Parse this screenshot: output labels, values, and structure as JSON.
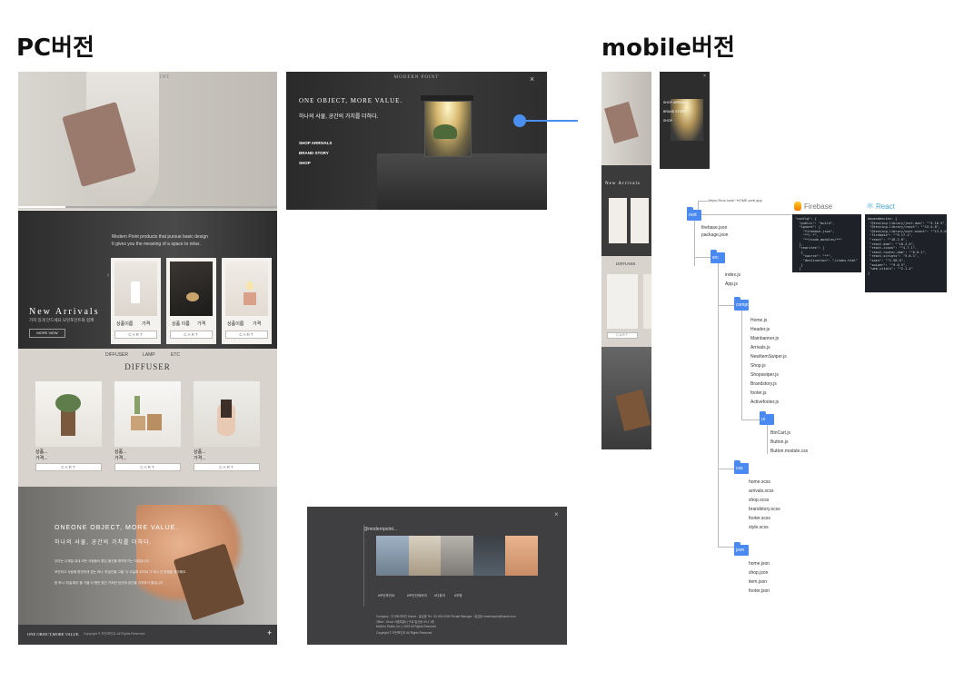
{
  "headings": {
    "pc": "PC버전",
    "mobile": "mobile버전"
  },
  "brand": "MODERN POINT",
  "hero": {
    "slogan": "ONE OBJECT, MORE VALUE.",
    "tagline": "하나의 사물, 공간의 가치를 더하다."
  },
  "menu": {
    "items": [
      "SHOP ARRIVALS",
      "BRAND STORY",
      "SHOP"
    ],
    "close": "×"
  },
  "arrivals": {
    "intro1": "Modern Point products that pursue basic design",
    "intro2": "It gives you the meaning of a space to relax.",
    "title": "New Arrivals",
    "subtitle": "가치 있게 만드세요 모던포인트와 함께",
    "more": "MORE VIEW",
    "products": [
      {
        "name": "상품이름",
        "price": "가격",
        "cart": "CART"
      },
      {
        "name": "상품 이름",
        "price": "가격",
        "cart": "CART"
      },
      {
        "name": "상품이름",
        "price": "가격",
        "cart": "CART"
      }
    ]
  },
  "shop": {
    "tabs": [
      "DIFFUSER",
      "LAMP",
      "ETC"
    ],
    "title": "DIFFUSER",
    "items": [
      {
        "name": "상품...",
        "price": "가격...",
        "cart": "CART"
      },
      {
        "name": "상품...",
        "price": "가격...",
        "cart": "CART"
      },
      {
        "name": "상품...",
        "price": "가격...",
        "cart": "CART"
      }
    ]
  },
  "story": {
    "title": "ONEONE OBJECT, MORE VALUE.",
    "subtitle": "하나의 사물, 공간의 가치를 더하다.",
    "p1": "우리는 사계절 내내 모든 사람들이 좋은 물건을 애착하기는 어렵습니다.",
    "p2": "모던하고 사람에 편안하게 접는 하나 '취공간을 그들' 더 사실에 우리의 그 의나 인 위협을 생각해요",
    "p3": "한 하나 '취설계대' 할 가을 이 평안 편간 가치란 당신에 공간을 가치하기 줄입니다."
  },
  "footer": {
    "slogan": "ONE OBJECT,MORE VALUE.",
    "copy": "Copyright © 모던포인트 All Rights Reserved.",
    "plus": "+"
  },
  "insta": {
    "handle": "@modernpoint...",
    "tags": [
      "#모던포인트",
      "#모던인테리어",
      "#디퓨저",
      "#조명"
    ],
    "info1": "Company : 주식회사모던 Owner : 홍길동 Tel : 00-000-0000 Private Manager : 홍길동 modernpoint@naver.com",
    "info2": "Office : Seoul 서울특별시 구로 발산동 00-1 1층",
    "info3": "Modern Studio, Inc. | 2023 All Rights Reserved",
    "info4": "Copyright © 모던포인트 All Rights Reserved."
  },
  "mobile": {
    "arrivals": "New Arrivals",
    "diffuser": "DIFFUSER",
    "cart": "CART"
  },
  "tree": {
    "url": "https://hos.host/~HOME.web.app",
    "root": "root",
    "rootFiles": [
      "firebase.json",
      "package.json"
    ],
    "src": "src",
    "srcFiles": [
      "index.js",
      "App.js"
    ],
    "components": "component",
    "compFiles": [
      "Home.js",
      "Header.js",
      "Mainbanner.js",
      "Arrivals.js",
      "NewItemSwiper.js",
      "Shop.js",
      "Shopswiper.js",
      "Brandstory.js",
      "footer.js",
      "Activefooter.js"
    ],
    "ui": "ui",
    "uiFiles": [
      "BtnCart.js",
      "Button.js",
      "Button.module.css"
    ],
    "css": "css",
    "cssFiles": [
      "home.scss",
      "arrivals.scss",
      "shop.scss",
      "brandstory.scss",
      "footer.scss",
      "style.scss"
    ],
    "json": "json",
    "jsonFiles": [
      "home.json",
      "shop.json",
      "item.json",
      "footer.json"
    ]
  },
  "tech": {
    "firebase": "Firebase",
    "react": "React",
    "firebaseCode": "\"config\": {\n  \"public\": \"build\",\n  \"ignore\": [\n    \"firebase.json\",\n    \"**/.*\",\n    \"**/node_modules/**\"\n  ],\n  \"rewrites\": [\n   {\n    \"source\": \"**\",\n    \"destination\": \"/index.html\"\n   }\n  ]\n}",
    "reactCode": "dependencies: {\n \"@testing-library/jest-dom\": \"^5.16.5\",\n \"@testing-library/react\": \"^13.4.0\",\n \"@testing-library/user-event\": \"^13.5.0\",\n \"firebase\": \"^9.17.1\",\n \"react\": \"^18.2.0\",\n \"react-dom\": \"^18.2.0\",\n \"react-icons\": \"^4.7.1\",\n \"react-router-dom\": \"^6.8.1\",\n \"react-scripts\": \"5.0.1\",\n \"sass\": \"^1.58.0\",\n \"swiper\": \"^9.0.5\",\n \"web-vitals\": \"^2.1.4\"\n}"
  }
}
